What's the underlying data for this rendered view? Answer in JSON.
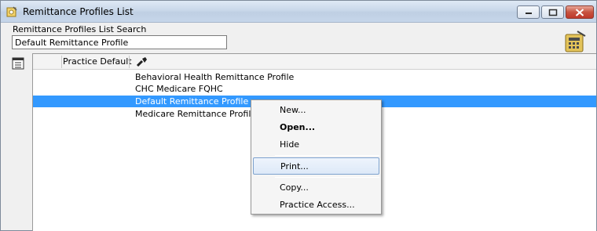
{
  "window": {
    "title": "Remittance Profiles List",
    "icon": "key-gear-icon"
  },
  "search": {
    "label": "Remittance Profiles List Search",
    "value": "Default Remittance Profile"
  },
  "grid": {
    "columns": [
      "Practice Default"
    ],
    "column_icon": "flashlight-icon",
    "rows": [
      "Behavioral Health Remittance Profile",
      "CHC Medicare FQHC",
      "Default Remittance Profile",
      "Medicare Remittance Profile"
    ],
    "selected_index": 2
  },
  "context_menu": {
    "items": [
      {
        "label": "New...",
        "bold": false
      },
      {
        "label": "Open...",
        "bold": true
      },
      {
        "label": "Hide",
        "bold": false
      },
      {
        "label": "Print...",
        "bold": false,
        "hover": true
      },
      {
        "label": "Copy...",
        "bold": false
      },
      {
        "label": "Practice Access...",
        "bold": false
      }
    ]
  },
  "colors": {
    "selection": "#3399ff",
    "titlebar": "#c9d8ea"
  }
}
